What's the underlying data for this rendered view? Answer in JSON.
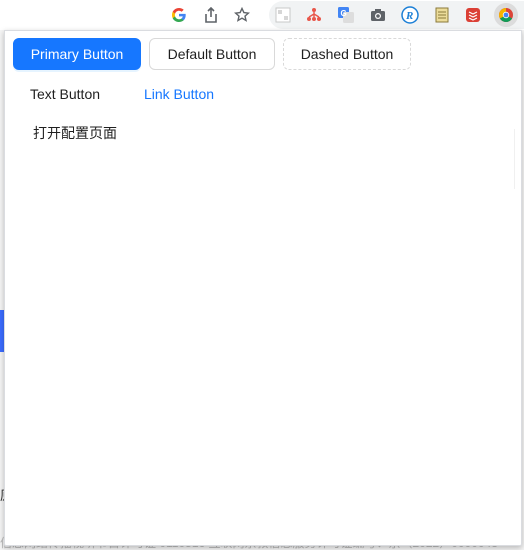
{
  "browser_toolbar": {
    "icons": [
      "google-g-icon",
      "share-icon",
      "star-icon"
    ],
    "extensions": [
      "ext-pattern-icon",
      "ext-tree-icon",
      "google-translate-icon",
      "camera-icon",
      "ext-r-icon",
      "ext-notebook-icon",
      "todoist-icon",
      "chrome-icon"
    ]
  },
  "background_page": {
    "side_char": "原",
    "footer_text": "信息网络传播视听节目许可证 0110516    互联网宗教信息服务许可证编号：京（2022）0000043"
  },
  "popup": {
    "buttons": {
      "primary": "Primary Button",
      "default": "Default Button",
      "dashed": "Dashed Button",
      "text": "Text Button",
      "link": "Link Button"
    },
    "open_config_label": "打开配置页面"
  },
  "colors": {
    "primary": "#1677ff",
    "border": "#d9d9d9",
    "toolbar_bg": "#f1f3f4"
  }
}
